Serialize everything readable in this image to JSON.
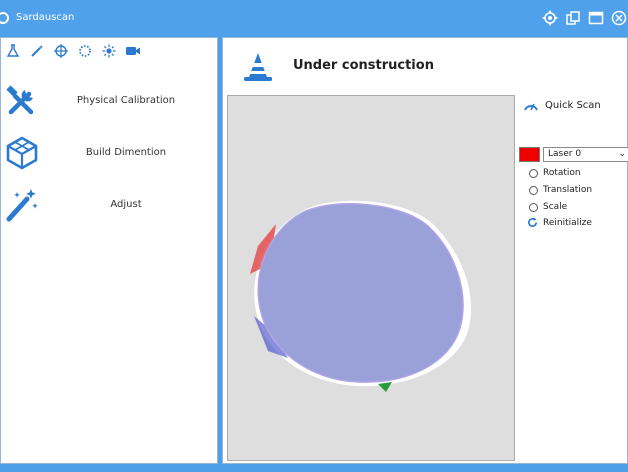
{
  "app": {
    "title": "Sardauscan"
  },
  "window_buttons": [
    "settings-icon",
    "copy-icon",
    "window-icon",
    "close-icon"
  ],
  "toolbar": [
    "flask-icon",
    "wand-icon",
    "target-icon",
    "dotted-circle-icon",
    "sun-icon",
    "camera-icon"
  ],
  "nav": [
    {
      "label": "Physical Calibration",
      "icon": "tools-icon"
    },
    {
      "label": "Build Dimention",
      "icon": "cube-icon"
    },
    {
      "label": "Adjust",
      "icon": "magic-wand-icon"
    }
  ],
  "main": {
    "title": "Under construction",
    "icon": "traffic-cone-icon"
  },
  "controls": {
    "quick_scan": "Quick Scan",
    "laser_color": "#ee0000",
    "laser_select": "Laser 0",
    "options": [
      "Rotation",
      "Translation",
      "Scale"
    ],
    "reinitialize": "Reinitialize"
  },
  "colors": {
    "accent": "#4ea1ea",
    "viewport": "#dedede",
    "blob": "#9aa0d8"
  }
}
